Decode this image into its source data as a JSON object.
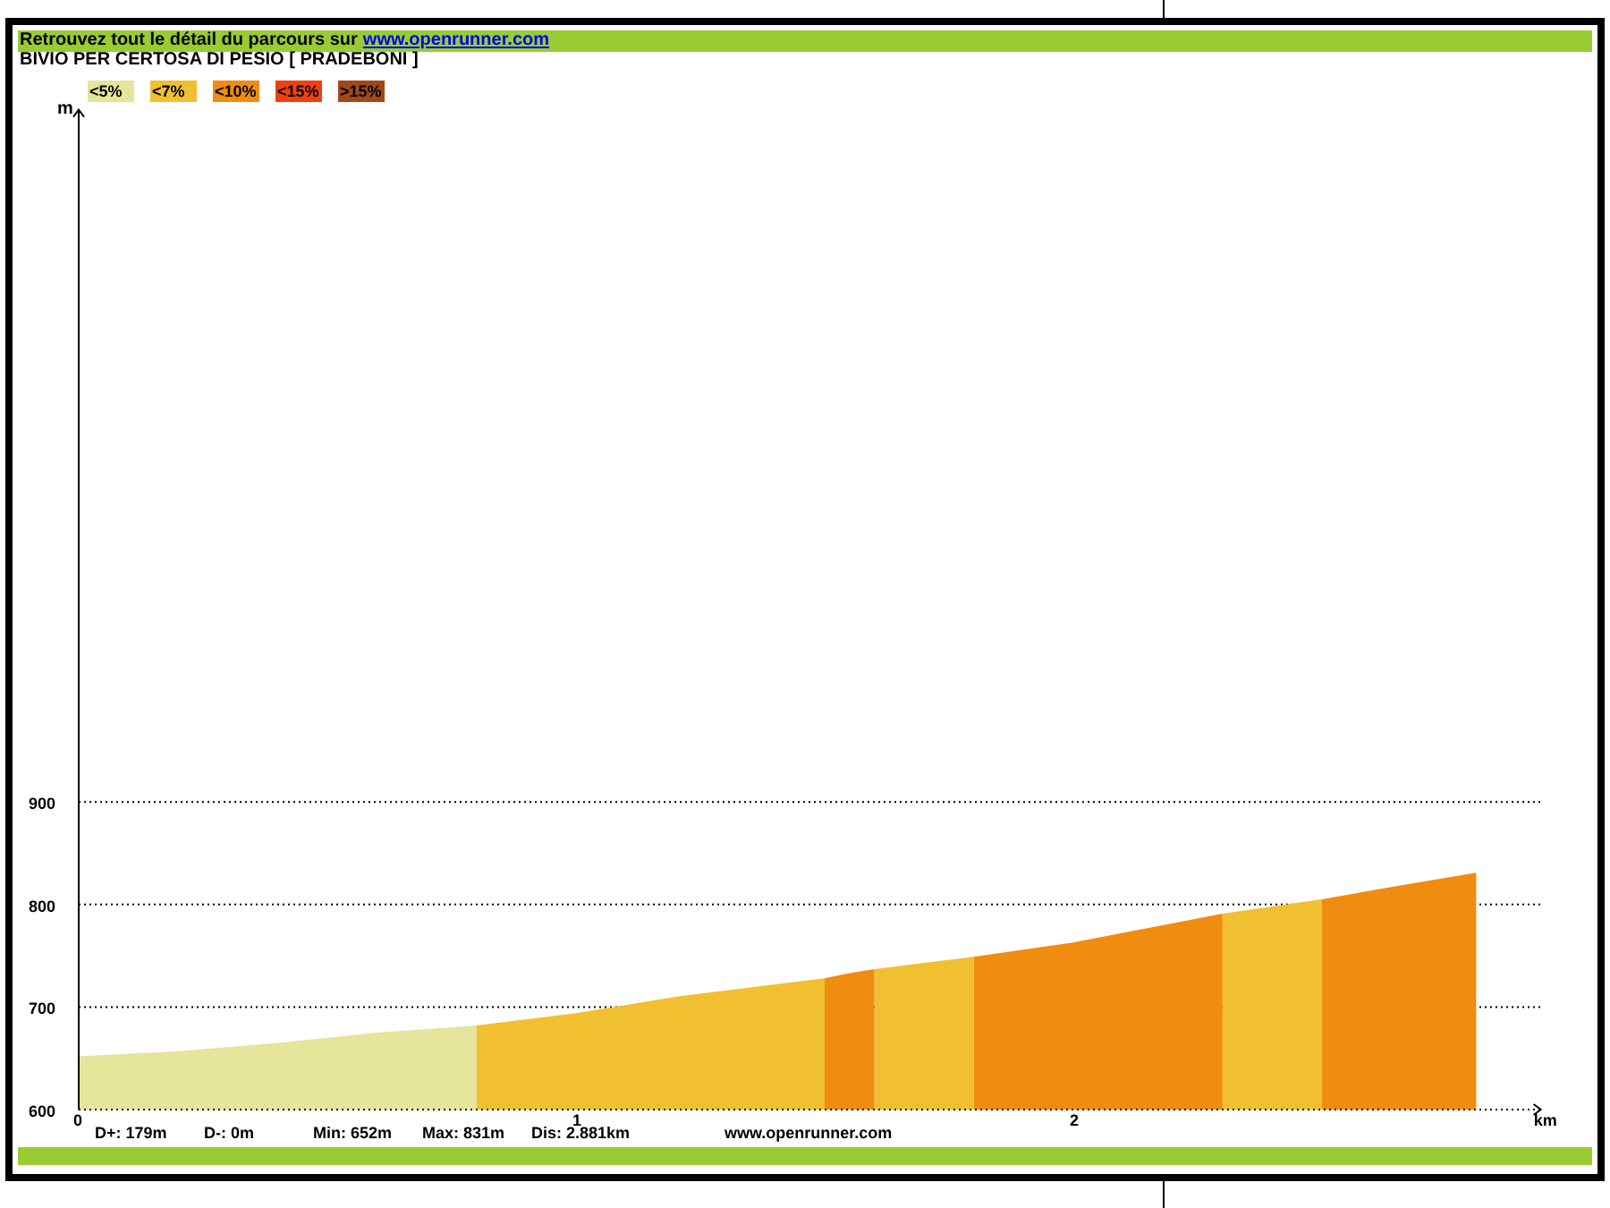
{
  "header": {
    "text": "Retrouvez tout le détail du parcours sur",
    "link": "www.openrunner.com"
  },
  "title": "BIVIO PER CERTOSA DI PESIO [ PRADEBONI ]",
  "chart": {
    "chart_data": {
      "type": "area",
      "xlabel": "km",
      "ylabel": "m",
      "x": [
        0,
        0.2,
        0.4,
        0.6,
        0.8,
        1.0,
        1.2,
        1.5,
        1.55,
        1.6,
        1.7,
        1.8,
        2.0,
        2.3,
        2.4,
        2.5,
        2.65,
        2.81
      ],
      "xlim": [
        0,
        2.94
      ],
      "ylim": [
        600,
        1575
      ],
      "xticks": [
        0,
        1,
        2
      ],
      "yticks": [
        600,
        700,
        800,
        900
      ],
      "stacked": false,
      "grid": true,
      "series": [
        {
          "name": "<5%",
          "color": "#e5e59b",
          "values": [
            652,
            657,
            665,
            675,
            682,
            null,
            null,
            null,
            null,
            null,
            null,
            null,
            null,
            null,
            null,
            null,
            null,
            null
          ]
        },
        {
          "name": "<7%",
          "color": "#f0c030",
          "values": [
            null,
            null,
            null,
            null,
            682,
            694,
            710,
            728,
            null,
            737,
            743,
            749,
            null,
            791,
            798,
            805,
            null,
            null
          ]
        },
        {
          "name": "<10%",
          "color": "#f08c10",
          "values": [
            null,
            null,
            null,
            null,
            null,
            null,
            null,
            728,
            733,
            737,
            null,
            749,
            763,
            791,
            null,
            805,
            818,
            831
          ]
        },
        {
          "name": "<15%",
          "color": "#f04010",
          "values": [
            null,
            null,
            null,
            null,
            null,
            null,
            null,
            null,
            null,
            null,
            null,
            null,
            null,
            null,
            null,
            null,
            null,
            null
          ]
        },
        {
          "name": ">15%",
          "color": "#a04818",
          "values": [
            null,
            null,
            null,
            null,
            null,
            null,
            null,
            null,
            null,
            null,
            null,
            null,
            null,
            null,
            null,
            null,
            null,
            null
          ]
        }
      ]
    }
  },
  "stats": [
    "D+: 179m",
    "D-: 0m",
    "Min: 652m",
    "Max: 831m",
    "Dis: 2.881km"
  ],
  "footer_link": "www.openrunner.com"
}
